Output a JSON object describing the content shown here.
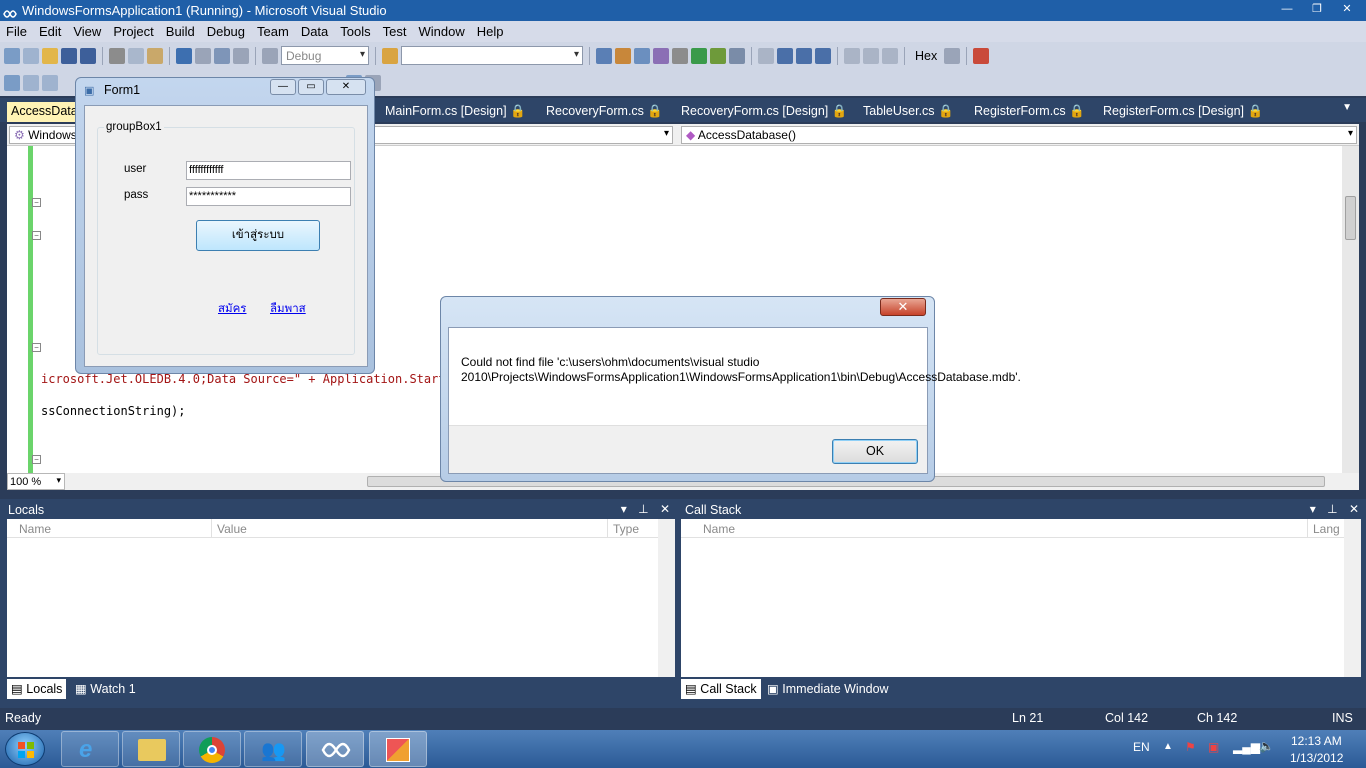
{
  "window": {
    "title": "WindowsFormsApplication1 (Running) - Microsoft Visual Studio"
  },
  "menu": [
    "File",
    "Edit",
    "View",
    "Project",
    "Build",
    "Debug",
    "Team",
    "Data",
    "Tools",
    "Test",
    "Window",
    "Help"
  ],
  "toolbar": {
    "config": "Debug",
    "hex_label": "Hex"
  },
  "tabs": [
    "AccessDatab",
    "MainForm.cs [Design]",
    "RecoveryForm.cs",
    "RecoveryForm.cs [Design]",
    "TableUser.cs",
    "RegisterForm.cs",
    "RegisterForm.cs [Design]"
  ],
  "nav": {
    "left": "Windows",
    "right": "AccessDatabase()"
  },
  "code": {
    "line1": "icrosoft.Jet.OLEDB.4.0;Data Source=\" + Application.Startu",
    "line2": "ssConnectionString);"
  },
  "zoom": "100 %",
  "form1": {
    "title": "Form1",
    "groupbox": "groupBox1",
    "user_label": "user",
    "pass_label": "pass",
    "user_value": "ffffffffffff",
    "pass_value": "***********",
    "login_button": "เข้าสู่ระบบ",
    "register_link": "สมัคร",
    "forgot_link": "ลืมพาส"
  },
  "dialog": {
    "message": "Could not find file 'c:\\users\\ohm\\documents\\visual studio 2010\\Projects\\WindowsFormsApplication1\\WindowsFormsApplication1\\bin\\Debug\\AccessDatabase.mdb'.",
    "ok": "OK",
    "close": "✕"
  },
  "locals": {
    "title": "Locals",
    "columns": [
      "Name",
      "Value",
      "Type"
    ],
    "tabs": [
      "Locals",
      "Watch 1"
    ]
  },
  "callstack": {
    "title": "Call Stack",
    "columns": [
      "Name",
      "Lang"
    ],
    "tabs": [
      "Call Stack",
      "Immediate Window"
    ]
  },
  "status": {
    "ready": "Ready",
    "ln": "Ln 21",
    "col": "Col 142",
    "ch": "Ch 142",
    "ins": "INS"
  },
  "taskbar": {
    "lang": "EN",
    "time": "12:13 AM",
    "date": "1/13/2012"
  }
}
